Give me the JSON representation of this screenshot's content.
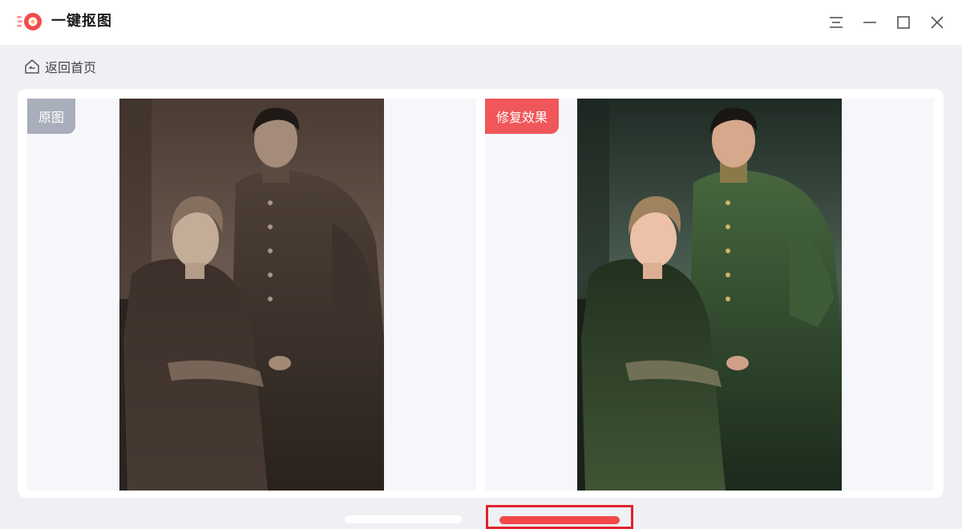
{
  "app": {
    "title": "一键抠图",
    "brand_color": "#f24d4d"
  },
  "window_controls": {
    "menu_icon": "menu-icon",
    "minimize_icon": "minimize-icon",
    "maximize_icon": "maximize-icon",
    "close_icon": "close-icon"
  },
  "nav": {
    "back_label": "返回首页",
    "back_icon": "home-icon"
  },
  "compare": {
    "original_label": "原图",
    "original_tag_color": "#a9aebb",
    "result_label": "修复效果",
    "result_tag_color": "#f0575a"
  },
  "highlight_color": "#e0222c"
}
